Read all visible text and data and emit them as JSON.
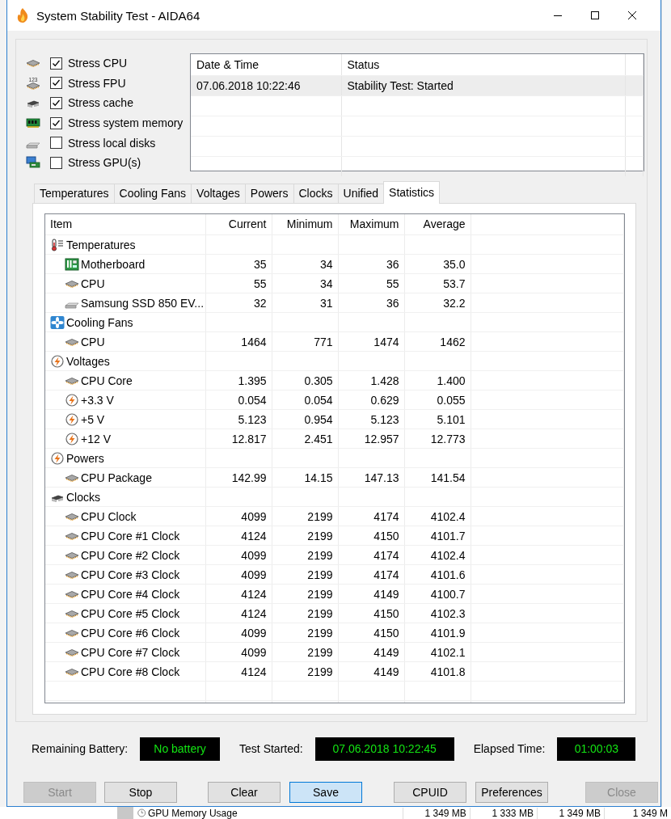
{
  "window": {
    "title": "System Stability Test - AIDA64"
  },
  "stress_options": [
    {
      "label": "Stress CPU",
      "checked": true,
      "kind": "cpu"
    },
    {
      "label": "Stress FPU",
      "checked": true,
      "kind": "fpu",
      "icon_text": "123"
    },
    {
      "label": "Stress cache",
      "checked": true,
      "kind": "cache"
    },
    {
      "label": "Stress system memory",
      "checked": true,
      "kind": "memory"
    },
    {
      "label": "Stress local disks",
      "checked": false,
      "kind": "disk"
    },
    {
      "label": "Stress GPU(s)",
      "checked": false,
      "kind": "gpu"
    }
  ],
  "log": {
    "columns": [
      "Date & Time",
      "Status"
    ],
    "rows": [
      {
        "cells": [
          "07.06.2018 10:22:46",
          "Stability Test: Started"
        ],
        "selected": true
      }
    ]
  },
  "tabs": [
    {
      "label": "Temperatures",
      "selected": false
    },
    {
      "label": "Cooling Fans",
      "selected": false
    },
    {
      "label": "Voltages",
      "selected": false
    },
    {
      "label": "Powers",
      "selected": false
    },
    {
      "label": "Clocks",
      "selected": false
    },
    {
      "label": "Unified",
      "selected": false
    },
    {
      "label": "Statistics",
      "selected": true
    }
  ],
  "statistics": {
    "columns": [
      "Item",
      "Current",
      "Minimum",
      "Maximum",
      "Average"
    ],
    "groups": [
      {
        "label": "Temperatures",
        "kind": "thermometer",
        "children": [
          {
            "label": "Motherboard",
            "kind": "motherboard",
            "values": [
              "35",
              "34",
              "36",
              "35.0"
            ]
          },
          {
            "label": "CPU",
            "kind": "cpu",
            "values": [
              "55",
              "34",
              "55",
              "53.7"
            ]
          },
          {
            "label": "Samsung SSD 850 EV...",
            "kind": "disk",
            "values": [
              "32",
              "31",
              "36",
              "32.2"
            ]
          }
        ]
      },
      {
        "label": "Cooling Fans",
        "kind": "fan",
        "children": [
          {
            "label": "CPU",
            "kind": "cpu",
            "values": [
              "1464",
              "771",
              "1474",
              "1462"
            ]
          }
        ]
      },
      {
        "label": "Voltages",
        "kind": "bolt",
        "children": [
          {
            "label": "CPU Core",
            "kind": "cpu",
            "values": [
              "1.395",
              "0.305",
              "1.428",
              "1.400"
            ]
          },
          {
            "label": "+3.3 V",
            "kind": "bolt",
            "values": [
              "0.054",
              "0.054",
              "0.629",
              "0.055"
            ]
          },
          {
            "label": "+5 V",
            "kind": "bolt",
            "values": [
              "5.123",
              "0.954",
              "5.123",
              "5.101"
            ]
          },
          {
            "label": "+12 V",
            "kind": "bolt",
            "values": [
              "12.817",
              "2.451",
              "12.957",
              "12.773"
            ]
          }
        ]
      },
      {
        "label": "Powers",
        "kind": "bolt",
        "children": [
          {
            "label": "CPU Package",
            "kind": "cpu",
            "values": [
              "142.99",
              "14.15",
              "147.13",
              "141.54"
            ]
          }
        ]
      },
      {
        "label": "Clocks",
        "kind": "chip",
        "children": [
          {
            "label": "CPU Clock",
            "kind": "cpu",
            "values": [
              "4099",
              "2199",
              "4174",
              "4102.4"
            ]
          },
          {
            "label": "CPU Core #1 Clock",
            "kind": "cpu",
            "values": [
              "4124",
              "2199",
              "4150",
              "4101.7"
            ]
          },
          {
            "label": "CPU Core #2 Clock",
            "kind": "cpu",
            "values": [
              "4099",
              "2199",
              "4174",
              "4102.4"
            ]
          },
          {
            "label": "CPU Core #3 Clock",
            "kind": "cpu",
            "values": [
              "4099",
              "2199",
              "4174",
              "4101.6"
            ]
          },
          {
            "label": "CPU Core #4 Clock",
            "kind": "cpu",
            "values": [
              "4124",
              "2199",
              "4149",
              "4100.7"
            ]
          },
          {
            "label": "CPU Core #5 Clock",
            "kind": "cpu",
            "values": [
              "4124",
              "2199",
              "4150",
              "4102.3"
            ]
          },
          {
            "label": "CPU Core #6 Clock",
            "kind": "cpu",
            "values": [
              "4099",
              "2199",
              "4150",
              "4101.9"
            ]
          },
          {
            "label": "CPU Core #7 Clock",
            "kind": "cpu",
            "values": [
              "4099",
              "2199",
              "4149",
              "4102.1"
            ]
          },
          {
            "label": "CPU Core #8 Clock",
            "kind": "cpu",
            "values": [
              "4124",
              "2199",
              "4149",
              "4101.8"
            ]
          }
        ]
      }
    ]
  },
  "status": [
    {
      "label": "Remaining Battery:",
      "value": "No battery"
    },
    {
      "label": "Test Started:",
      "value": "07.06.2018 10:22:45"
    },
    {
      "label": "Elapsed Time:",
      "value": "01:00:03"
    }
  ],
  "buttons": [
    {
      "label": "Start",
      "disabled": true,
      "focused": false
    },
    {
      "label": "Stop",
      "disabled": false,
      "focused": false
    },
    {
      "label": "Clear",
      "disabled": false,
      "focused": false
    },
    {
      "label": "Save",
      "disabled": false,
      "focused": true
    },
    {
      "label": "CPUID",
      "disabled": false,
      "focused": false
    },
    {
      "label": "Preferences",
      "disabled": false,
      "focused": false
    },
    {
      "label": "Close",
      "disabled": true,
      "focused": false
    }
  ],
  "background_window": {
    "label": "GPU Memory Usage",
    "values": [
      "1 349 MB",
      "1 333 MB",
      "1 349 MB",
      "1 349 M"
    ]
  }
}
